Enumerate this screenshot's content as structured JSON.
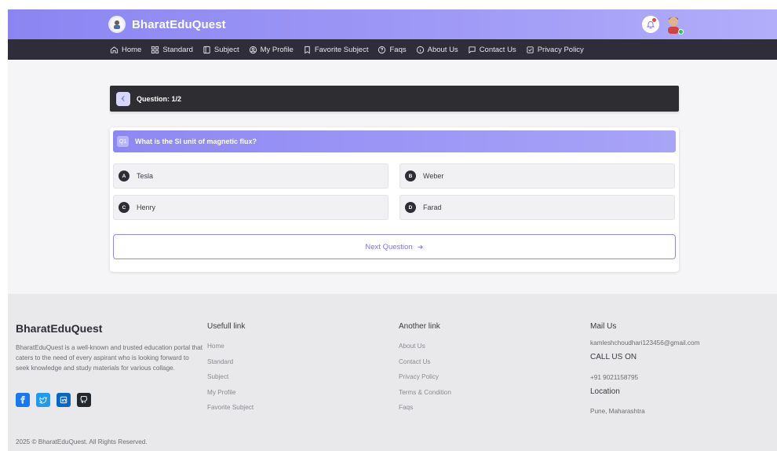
{
  "header": {
    "brand": "BharatEduQuest"
  },
  "nav": {
    "items": [
      {
        "label": "Home",
        "icon": "home-icon"
      },
      {
        "label": "Standard",
        "icon": "grid-icon"
      },
      {
        "label": "Subject",
        "icon": "book-icon"
      },
      {
        "label": "My Profile",
        "icon": "user-circle-icon"
      },
      {
        "label": "Favorite Subject",
        "icon": "bookmark-icon"
      },
      {
        "label": "Faqs",
        "icon": "help-circle-icon"
      },
      {
        "label": "About Us",
        "icon": "info-icon"
      },
      {
        "label": "Contact Us",
        "icon": "chat-icon"
      },
      {
        "label": "Privacy Policy",
        "icon": "check-square-icon"
      }
    ]
  },
  "quiz": {
    "header_label": "Question: 1/2",
    "question_number": "Q1",
    "question_text": "What is the SI unit of magnetic flux?",
    "options": [
      {
        "letter": "A",
        "text": "Tesla"
      },
      {
        "letter": "B",
        "text": "Weber"
      },
      {
        "letter": "C",
        "text": "Henry"
      },
      {
        "letter": "D",
        "text": "Farad"
      }
    ],
    "next_label": "Next Question"
  },
  "footer": {
    "brand": "BharatEduQuest",
    "description": "BharatEduQuest is a well-known and trusted education portal that caters to the need of every aspirant who is looking forward to seek knowledge and study materials for various collage.",
    "copyright": "2025 © BharatEduQuest. All Rights Reserved.",
    "useful": {
      "title": "Usefull link",
      "links": [
        "Home",
        "Standard",
        "Subject",
        "My Profile",
        "Favorite Subject"
      ]
    },
    "another": {
      "title": "Another link",
      "links": [
        "About Us",
        "Contact Us",
        "Privacy Policy",
        "Terms & Condition",
        "Faqs"
      ]
    },
    "contact": {
      "mail_title": "Mail Us",
      "email": "kamleshchoudhari123456@gmail.com",
      "call_title": "CALL US ON",
      "phone": "+91 9021158795",
      "location_title": "Location",
      "location": "Pune, Maharashtra"
    }
  },
  "colors": {
    "accent": "#8e88f4",
    "dark": "#2e2d39",
    "facebook": "#1877f2",
    "twitter": "#1d9bf0",
    "linkedin": "#0a66c2",
    "github": "#24292f"
  }
}
